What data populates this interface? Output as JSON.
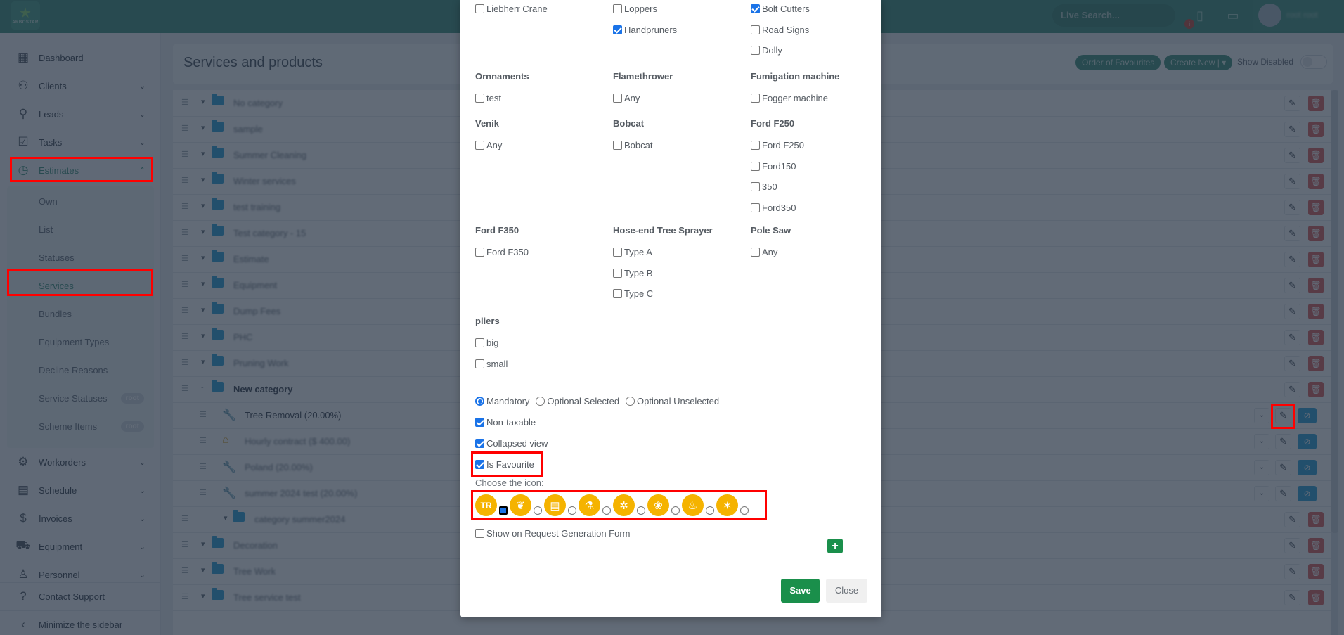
{
  "header": {
    "logo_text": "ARBOSTAR",
    "live_search_placeholder": "Live Search...",
    "notification_count": "i",
    "user_name": "root root"
  },
  "sidebar": {
    "items": [
      {
        "label": "Dashboard",
        "icon": "dashboard-icon"
      },
      {
        "label": "Clients",
        "icon": "users-icon",
        "expandable": true
      },
      {
        "label": "Leads",
        "icon": "user-plus-icon",
        "expandable": true
      },
      {
        "label": "Tasks",
        "icon": "checkbox-icon",
        "expandable": true
      },
      {
        "label": "Estimates",
        "icon": "clock-icon",
        "expandable": true,
        "expanded": true,
        "active": true
      },
      {
        "label": "Workorders",
        "icon": "gear-icon",
        "expandable": true
      },
      {
        "label": "Schedule",
        "icon": "calendar-icon",
        "expandable": true
      },
      {
        "label": "Invoices",
        "icon": "dollar-icon",
        "expandable": true
      },
      {
        "label": "Equipment",
        "icon": "truck-icon",
        "expandable": true
      },
      {
        "label": "Personnel",
        "icon": "person-icon",
        "expandable": true
      }
    ],
    "estimates_sub": [
      {
        "label": "Own"
      },
      {
        "label": "List"
      },
      {
        "label": "Statuses"
      },
      {
        "label": "Services",
        "active": true
      },
      {
        "label": "Bundles"
      },
      {
        "label": "Equipment Types"
      },
      {
        "label": "Decline Reasons"
      },
      {
        "label": "Service Statuses",
        "badge": "root"
      },
      {
        "label": "Scheme Items",
        "badge": "root"
      }
    ],
    "contact_support": "Contact Support",
    "minimize": "Minimize the sidebar"
  },
  "page": {
    "title": "Services and products",
    "order_favourites": "Order of Favourites",
    "create_new": "Create New |",
    "show_disabled": "Show Disabled"
  },
  "list": {
    "rows": [
      {
        "name": "No category",
        "type": "category"
      },
      {
        "name": "sample",
        "type": "category"
      },
      {
        "name": "Summer Cleaning",
        "type": "category"
      },
      {
        "name": "Winter services",
        "type": "category"
      },
      {
        "name": "test training",
        "type": "category"
      },
      {
        "name": "Test category - 15",
        "type": "category"
      },
      {
        "name": "Estimate",
        "type": "category"
      },
      {
        "name": "Equipment",
        "type": "category"
      },
      {
        "name": "Dump Fees",
        "type": "category"
      },
      {
        "name": "PHC",
        "type": "category"
      },
      {
        "name": "Pruning Work",
        "type": "category"
      },
      {
        "name": "New category",
        "type": "category",
        "expanded": true
      },
      {
        "name": "Tree Removal (20.00%)",
        "type": "service"
      },
      {
        "name": "Hourly contract ($ 400.00)",
        "type": "service"
      },
      {
        "name": "Poland (20.00%)",
        "type": "service"
      },
      {
        "name": "summer 2024 test (20.00%)",
        "type": "service"
      },
      {
        "name": "category summer2024",
        "type": "subcategory"
      },
      {
        "name": "Decoration",
        "type": "category"
      },
      {
        "name": "Tree Work",
        "type": "category"
      },
      {
        "name": "Tree service test",
        "type": "category"
      }
    ]
  },
  "modal": {
    "equipment_groups": [
      {
        "title": "",
        "options": [
          {
            "label": "Liebherr Crane",
            "checked": false
          }
        ]
      },
      {
        "title": "",
        "options": [
          {
            "label": "Loppers",
            "checked": false
          },
          {
            "label": "Handpruners",
            "checked": true
          }
        ]
      },
      {
        "title": "",
        "options": [
          {
            "label": "Bolt Cutters",
            "checked": true
          },
          {
            "label": "Road Signs",
            "checked": false
          },
          {
            "label": "Dolly",
            "checked": false
          }
        ]
      },
      {
        "title": "Ornnaments",
        "options": [
          {
            "label": "test",
            "checked": false
          }
        ]
      },
      {
        "title": "Flamethrower",
        "options": [
          {
            "label": "Any",
            "checked": false
          }
        ]
      },
      {
        "title": "Fumigation machine",
        "options": [
          {
            "label": "Fogger machine",
            "checked": false
          }
        ]
      },
      {
        "title": "Venik",
        "options": [
          {
            "label": "Any",
            "checked": false
          }
        ]
      },
      {
        "title": "Bobcat",
        "options": [
          {
            "label": "Bobcat",
            "checked": false
          }
        ]
      },
      {
        "title": "Ford F250",
        "options": [
          {
            "label": "Ford F250",
            "checked": false
          },
          {
            "label": "Ford150",
            "checked": false
          },
          {
            "label": "350",
            "checked": false
          },
          {
            "label": "Ford350",
            "checked": false
          }
        ]
      },
      {
        "title": "Ford F350",
        "options": [
          {
            "label": "Ford F350",
            "checked": false
          }
        ]
      },
      {
        "title": "Hose-end Tree Sprayer",
        "options": [
          {
            "label": "Type A",
            "checked": false
          },
          {
            "label": "Type B",
            "checked": false
          },
          {
            "label": "Type C",
            "checked": false
          }
        ]
      },
      {
        "title": "Pole Saw",
        "options": [
          {
            "label": "Any",
            "checked": false
          }
        ]
      },
      {
        "title": "pliers",
        "options": [
          {
            "label": "big",
            "checked": false
          },
          {
            "label": "small",
            "checked": false
          }
        ]
      }
    ],
    "mode_options": [
      {
        "label": "Mandatory",
        "checked": true
      },
      {
        "label": "Optional Selected",
        "checked": false
      },
      {
        "label": "Optional Unselected",
        "checked": false
      }
    ],
    "non_taxable": {
      "label": "Non-taxable",
      "checked": true
    },
    "collapsed_view": {
      "label": "Collapsed view",
      "checked": true
    },
    "is_favourite": {
      "label": "Is Favourite",
      "checked": true
    },
    "choose_icon_label": "Choose the icon:",
    "icons": [
      {
        "name": "initials-tr-icon",
        "text": "TR",
        "selected": true
      },
      {
        "name": "tree-roots-icon",
        "text": "",
        "selected": false
      },
      {
        "name": "document-chart-icon",
        "text": "",
        "selected": false
      },
      {
        "name": "microscope-leaf-icon",
        "text": "",
        "selected": false
      },
      {
        "name": "tree-shovel-icon",
        "text": "",
        "selected": false
      },
      {
        "name": "tree-saw-icon",
        "text": "",
        "selected": false
      },
      {
        "name": "stump-icon",
        "text": "",
        "selected": false
      },
      {
        "name": "christmas-tree-icon",
        "text": "",
        "selected": false
      }
    ],
    "show_on_request": {
      "label": "Show on Request Generation Form",
      "checked": false
    },
    "save": "Save",
    "close": "Close"
  },
  "colors": {
    "brand_green": "#2f8a73",
    "save_green": "#1a8f4b",
    "icon_yellow": "#f5b300",
    "checkbox_blue": "#1a73e8",
    "delete_red": "#d9534f",
    "highlight_red": "#ff0000"
  }
}
